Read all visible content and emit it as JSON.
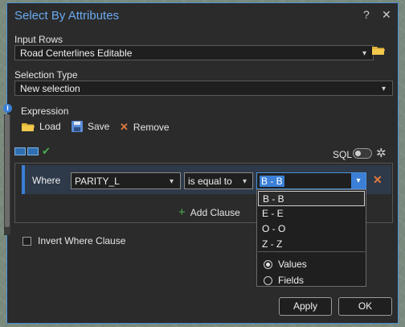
{
  "dialog": {
    "title": "Select By Attributes",
    "help_icon": "?",
    "close_icon": "✕"
  },
  "input_rows": {
    "label": "Input Rows",
    "value": "Road Centerlines Editable"
  },
  "selection_type": {
    "label": "Selection Type",
    "value": "New selection"
  },
  "expression": {
    "label": "Expression",
    "info_icon": "i"
  },
  "toolbar": {
    "load": "Load",
    "save": "Save",
    "remove": "Remove"
  },
  "sql": {
    "label": "SQL",
    "enabled": false
  },
  "clause": {
    "where_label": "Where",
    "field": "PARITY_L",
    "operator": "is equal to",
    "value": "B - B"
  },
  "add_clause": "Add Clause",
  "invert": {
    "label": "Invert Where Clause",
    "checked": false
  },
  "value_dropdown": {
    "options": [
      "B - B",
      "E - E",
      "O - O",
      "Z - Z"
    ],
    "mode": {
      "values": "Values",
      "fields": "Fields",
      "selected": "Values"
    }
  },
  "footer": {
    "apply": "Apply",
    "ok": "OK"
  },
  "colors": {
    "accent": "#3b7fd6",
    "title": "#6aaaf0",
    "remove": "#e07a3c",
    "add": "#4caf50"
  }
}
